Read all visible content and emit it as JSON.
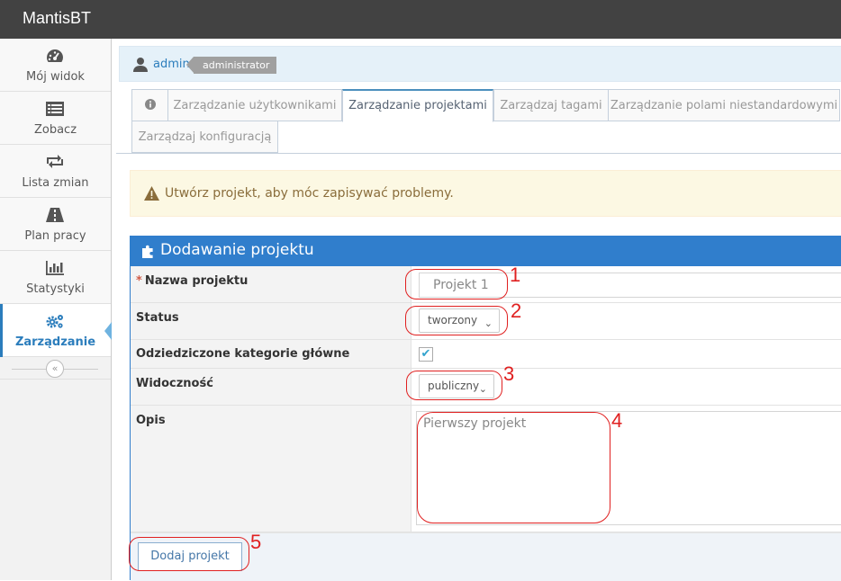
{
  "app": {
    "brand": "MantisBT"
  },
  "sidebar": {
    "items": [
      {
        "label": "Mój widok",
        "icon": "dashboard-icon"
      },
      {
        "label": "Zobacz",
        "icon": "list-icon"
      },
      {
        "label": "Lista zmian",
        "icon": "retweet-icon"
      },
      {
        "label": "Plan pracy",
        "icon": "road-icon"
      },
      {
        "label": "Statystyki",
        "icon": "bar-chart-icon"
      },
      {
        "label": "Zarządzanie",
        "icon": "gears-icon",
        "active": true
      }
    ],
    "collapse_icon": "double-chevron-left-icon",
    "collapse_glyph": "«"
  },
  "breadcrumb": {
    "user": "admin",
    "role": "administrator"
  },
  "tabs": [
    {
      "label": "",
      "icon": "info-icon"
    },
    {
      "label": "Zarządzanie użytkownikami"
    },
    {
      "label": "Zarządzanie projektami",
      "active": true
    },
    {
      "label": "Zarządzaj tagami"
    },
    {
      "label": "Zarządzanie polami niestandardowymi"
    },
    {
      "label": "Zarządzaj konfiguracją"
    }
  ],
  "alert": {
    "text": "Utwórz projekt, aby móc zapisywać problemy.",
    "icon": "warning-icon"
  },
  "form": {
    "title": "Dodawanie projektu",
    "title_icon": "puzzle-icon",
    "name_label": "Nazwa projektu",
    "name_required_mark": "*",
    "name_value": "Projekt 1",
    "status_label": "Status",
    "status_value": "tworzony",
    "inherit_label": "Odziedziczone kategorie główne",
    "inherit_checked": true,
    "inherit_check_glyph": "✔",
    "visibility_label": "Widoczność",
    "visibility_value": "publiczny",
    "select_chevron": "⌄",
    "description_label": "Opis",
    "description_value": "Pierwszy projekt",
    "submit_label": "Dodaj projekt"
  },
  "annotations": [
    "1",
    "2",
    "3",
    "4",
    "5"
  ],
  "colors": {
    "navbar": "#424242",
    "accent": "#307ecc",
    "annotation": "#e02020",
    "alert_bg": "#fcf8e3"
  }
}
